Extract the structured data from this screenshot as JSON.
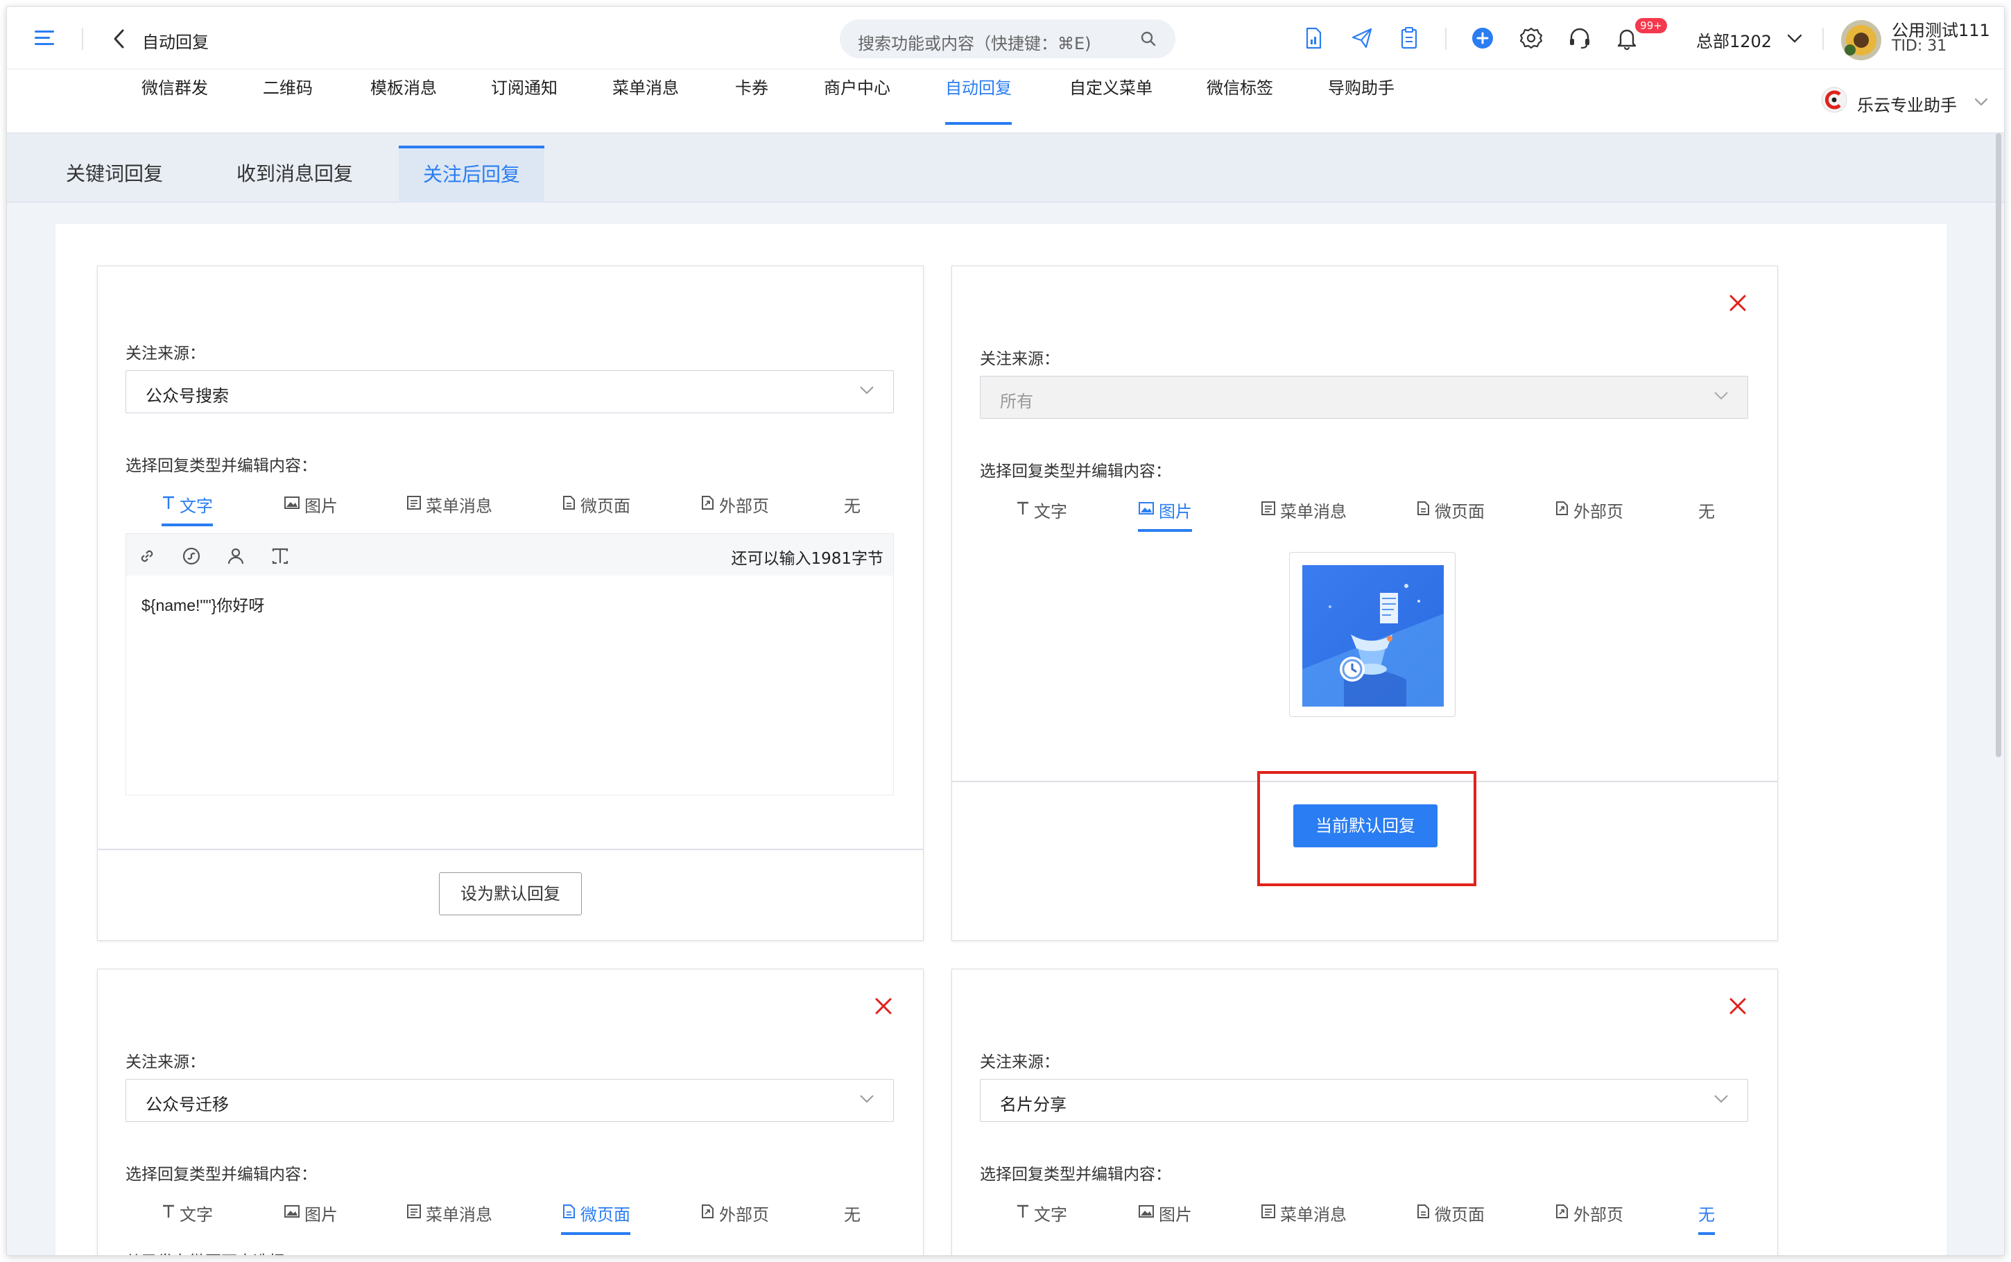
{
  "header": {
    "back_label": "自动回复",
    "search_placeholder": "搜索功能或内容（快捷键：⌘E)",
    "notification_badge": "99+",
    "org_name": "总部1202",
    "user_name": "公用测试111",
    "tenant_id": "TID: 31"
  },
  "nav": {
    "items": [
      "微信群发",
      "二维码",
      "模板消息",
      "订阅通知",
      "菜单消息",
      "卡券",
      "商户中心",
      "自动回复",
      "自定义菜单",
      "微信标签",
      "导购助手"
    ],
    "active_index": 7,
    "assistant_label": "乐云专业助手"
  },
  "subtabs": {
    "items": [
      "关键词回复",
      "收到消息回复",
      "关注后回复"
    ],
    "active_index": 2
  },
  "labels": {
    "source": "关注来源：",
    "reply_type": "选择回复类型并编辑内容："
  },
  "reply_types": [
    "文字",
    "图片",
    "菜单消息",
    "微页面",
    "外部页",
    "无"
  ],
  "cards": [
    {
      "source": "公众号搜索",
      "active_type": 0,
      "char_remaining": "还可以输入1981字节",
      "text_content": "${name!\"\"}你好呀",
      "button": "设为默认回复"
    },
    {
      "source": "所有",
      "source_disabled": true,
      "active_type": 1,
      "button": "当前默认回复"
    },
    {
      "source": "公众号迁移",
      "active_type": 3,
      "partial_text": "从已发布微页面中选择"
    },
    {
      "source": "名片分享",
      "active_type": 5
    }
  ],
  "colors": {
    "accent": "#2a7df2",
    "delete": "#e0221c",
    "highlight_box": "#e0221c",
    "badge": "#f5384d"
  }
}
